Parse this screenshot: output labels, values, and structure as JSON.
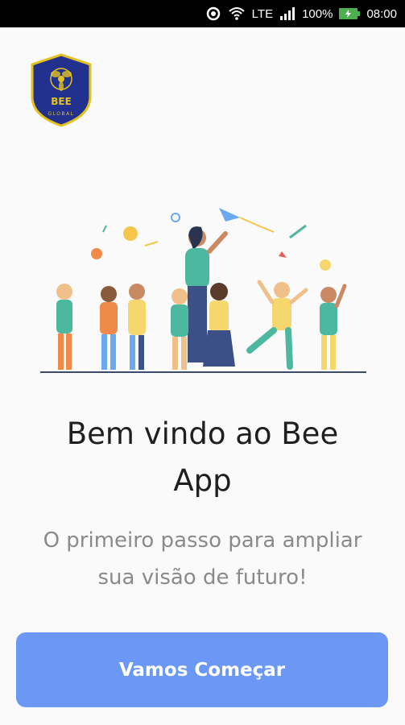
{
  "status_bar": {
    "network": "LTE",
    "battery": "100%",
    "time": "08:00",
    "icons": [
      "sync-icon",
      "wifi-icon",
      "signal-icon",
      "battery-icon"
    ]
  },
  "logo": {
    "top_text": "BEE",
    "bottom_text": "GLOBAL",
    "colors": {
      "shield": "#22318e",
      "border": "#e3c21f",
      "bee": "#e3c21f"
    }
  },
  "illustration": {
    "description_icon": "teacher-with-children-illustration",
    "colors": {
      "ground": "#3a4a6b",
      "teal": "#4cb8a0",
      "orange": "#f08a4b",
      "yellow": "#f5d76e"
    }
  },
  "welcome": {
    "title_line1": "Bem vindo ao Bee",
    "title_line2": "App",
    "subtitle_line1": "O primeiro passo para ampliar",
    "subtitle_line2": "sua visão de futuro!"
  },
  "cta": {
    "label": "Vamos Começar",
    "color": "#6b98f5"
  }
}
